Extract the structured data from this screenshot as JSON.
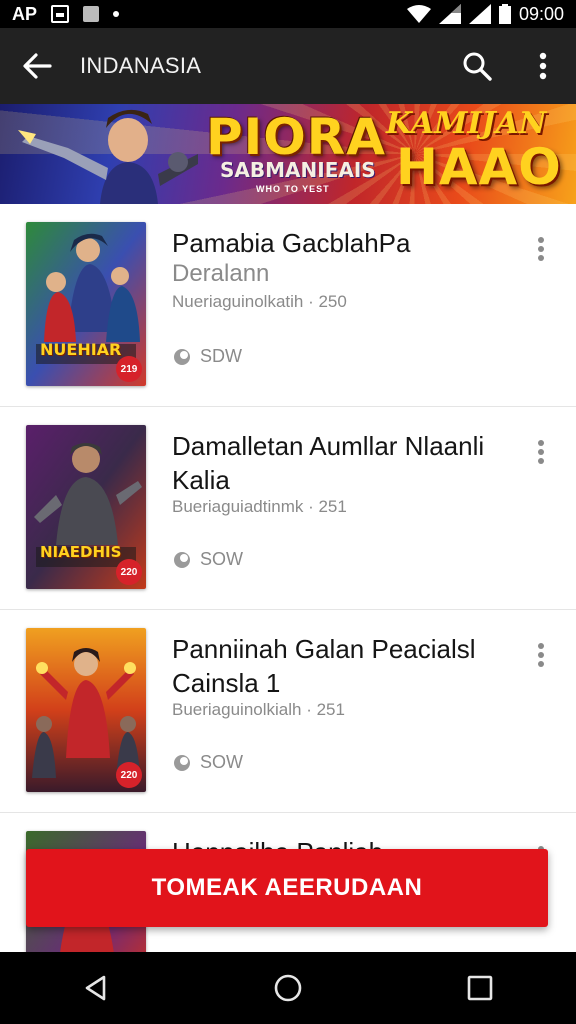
{
  "status_bar": {
    "carrier": "AP",
    "time": "09:00"
  },
  "app_bar": {
    "title": "INDANASIA",
    "back_icon": "arrow-left-icon",
    "search_icon": "search-icon",
    "menu_icon": "more-vertical-icon"
  },
  "banner": {
    "title": "PIORA",
    "subtitle": "SABMANIEAIS",
    "tagline": "WHO TO YEST",
    "right_line1": "KAMIJAN",
    "right_line2": "HAAO"
  },
  "items": [
    {
      "title": "Pamabia GacblahPa",
      "subtitle": "Deralann",
      "meta": "Nueriaguinolkatih · 250",
      "count": "SDW",
      "cover_text": "NUEHIAR",
      "cover_badge": "219"
    },
    {
      "title": "Damalletan Aumllar Nlaanli Kalia",
      "meta": "Bueriaguiadtinmk · 251",
      "count": "SOW",
      "cover_text": "NIAEDHIS",
      "cover_badge": "220"
    },
    {
      "title": "Panniinah Galan Peacialsl Cainsla 1",
      "meta": "Bueriaguinolkialh · 251",
      "count": "SOW",
      "cover_text": "",
      "cover_badge": "220"
    },
    {
      "title": "Hennailbe Panliah"
    }
  ],
  "cta": {
    "label": "TOMEAK AEERUDAAN"
  },
  "colors": {
    "accent": "#e1141b",
    "app_bar": "#222222",
    "status_bar": "#000000"
  }
}
